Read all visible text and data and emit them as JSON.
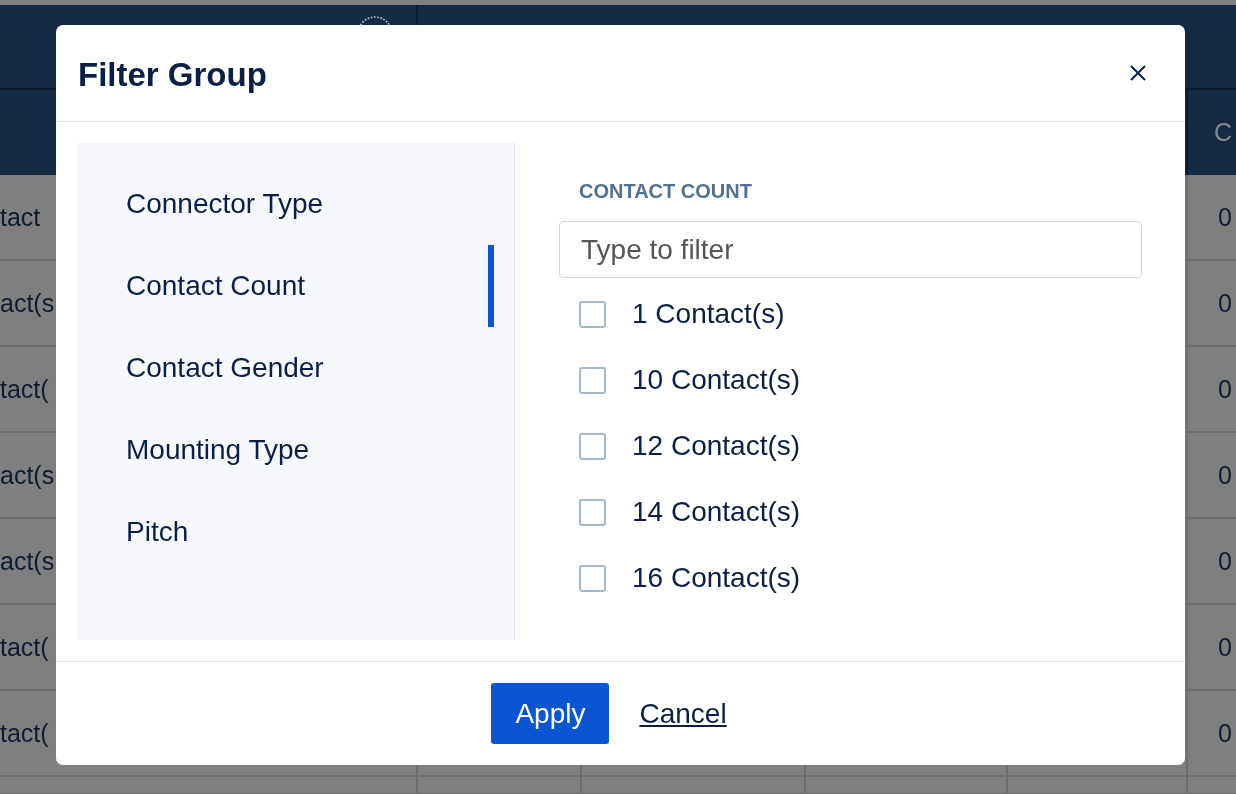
{
  "background_table": {
    "header_text": "C",
    "rows": [
      {
        "column_1": "tact",
        "column_6": "0"
      },
      {
        "column_1": "act(s",
        "column_6": "0"
      },
      {
        "column_1": "tact(",
        "column_6": "0"
      },
      {
        "column_1": "act(s",
        "column_6": "0"
      },
      {
        "column_1": "act(s",
        "column_6": "0"
      },
      {
        "column_1": "tact(",
        "column_6": "0"
      },
      {
        "column_1": "tact(",
        "column_6": "0"
      }
    ]
  },
  "dialog": {
    "title": "Filter Group",
    "categories": [
      {
        "label": "Connector Type",
        "selected": false
      },
      {
        "label": "Contact Count",
        "selected": true
      },
      {
        "label": "Contact Gender",
        "selected": false
      },
      {
        "label": "Mounting Type",
        "selected": false
      },
      {
        "label": "Pitch",
        "selected": false
      }
    ],
    "panel": {
      "heading": "CONTACT COUNT",
      "search": {
        "placeholder": "Type to filter"
      },
      "options": [
        {
          "label": "1 Contact(s)",
          "checked": false
        },
        {
          "label": "10 Contact(s)",
          "checked": false
        },
        {
          "label": "12 Contact(s)",
          "checked": false
        },
        {
          "label": "14 Contact(s)",
          "checked": false
        },
        {
          "label": "16 Contact(s)",
          "checked": false
        }
      ]
    },
    "buttons": [
      {
        "label": "Apply",
        "kind": "primary"
      },
      {
        "label": "Cancel",
        "kind": "link"
      }
    ]
  }
}
